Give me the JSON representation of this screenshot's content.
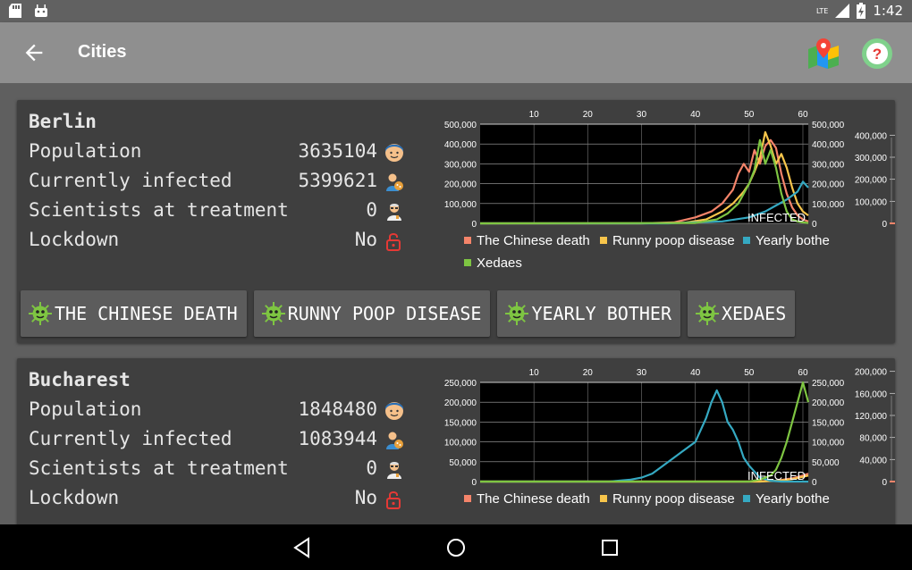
{
  "statusbar": {
    "lte": "LTE",
    "time": "1:42"
  },
  "appbar": {
    "title": "Cities"
  },
  "cities": [
    {
      "name": "Berlin",
      "population_label": "Population",
      "population": "3635104",
      "infected_label": "Currently infected",
      "infected": "5399621",
      "scientists_label": "Scientists at treatment",
      "scientists": "0",
      "lockdown_label": "Lockdown",
      "lockdown": "No"
    },
    {
      "name": "Bucharest",
      "population_label": "Population",
      "population": "1848480",
      "infected_label": "Currently infected",
      "infected": "1083944",
      "scientists_label": "Scientists at treatment",
      "scientists": "0",
      "lockdown_label": "Lockdown",
      "lockdown": "No"
    }
  ],
  "virus_buttons": [
    "THE CHINESE DEATH",
    "RUNNY POOP DISEASE",
    "YEARLY BOTHER",
    "XEDAES"
  ],
  "colors": {
    "chinese": "#f4846a",
    "runny": "#f7c54b",
    "yearly": "#35a9c2",
    "xedaes": "#7ec542"
  },
  "chart_data": [
    {
      "type": "line",
      "x_ticks": [
        10,
        20,
        30,
        40,
        50,
        60
      ],
      "left_ticks": [
        "0",
        "100,000",
        "200,000",
        "300,000",
        "400,000",
        "500,000"
      ],
      "left_ylim": [
        0,
        500000
      ],
      "right_ticks": [
        "0",
        "100,000",
        "200,000",
        "300,000",
        "400,000",
        "500,000"
      ],
      "right2_ticks": [
        "0",
        "100,000",
        "200,000",
        "300,000",
        "400,000"
      ],
      "annotation": "INFECTED",
      "legend": [
        "The Chinese death",
        "Runny poop disease",
        "Yearly bothe",
        "Xedaes"
      ],
      "series": [
        {
          "key": "chinese",
          "x": [
            0,
            30,
            36,
            40,
            43,
            45,
            47,
            48,
            49,
            50,
            51,
            52,
            53,
            54,
            55,
            56,
            57,
            58,
            59,
            60,
            61
          ],
          "values": [
            0,
            0,
            5000,
            30000,
            60000,
            100000,
            170000,
            250000,
            300000,
            260000,
            370000,
            300000,
            390000,
            420000,
            380000,
            250000,
            150000,
            80000,
            40000,
            20000,
            10000
          ]
        },
        {
          "key": "runny",
          "x": [
            0,
            30,
            38,
            42,
            45,
            47,
            49,
            50,
            51,
            52,
            53,
            54,
            55,
            56,
            57,
            58,
            59,
            60,
            61
          ],
          "values": [
            0,
            0,
            3000,
            20000,
            60000,
            100000,
            160000,
            200000,
            260000,
            330000,
            460000,
            390000,
            300000,
            350000,
            280000,
            180000,
            100000,
            60000,
            40000
          ]
        },
        {
          "key": "yearly",
          "x": [
            0,
            35,
            45,
            50,
            53,
            55,
            57,
            59,
            60,
            61
          ],
          "values": [
            0,
            0,
            10000,
            30000,
            60000,
            90000,
            120000,
            160000,
            210000,
            180000
          ]
        },
        {
          "key": "xedaes",
          "x": [
            0,
            40,
            44,
            46,
            48,
            49,
            50,
            51,
            52,
            53,
            54,
            55,
            56,
            57,
            58,
            59,
            60,
            61
          ],
          "values": [
            0,
            2000,
            20000,
            50000,
            100000,
            150000,
            200000,
            270000,
            420000,
            300000,
            370000,
            280000,
            150000,
            60000,
            20000,
            10000,
            5000,
            2000
          ]
        }
      ]
    },
    {
      "type": "line",
      "x_ticks": [
        10,
        20,
        30,
        40,
        50,
        60
      ],
      "left_ticks": [
        "0",
        "50,000",
        "100,000",
        "150,000",
        "200,000",
        "250,000"
      ],
      "left_ylim": [
        0,
        250000
      ],
      "right_ticks": [
        "0",
        "50,000",
        "100,000",
        "150,000",
        "200,000",
        "250,000"
      ],
      "right2_ticks": [
        "0",
        "40,000",
        "80,000",
        "120,000",
        "160,000",
        "200,000"
      ],
      "annotation": "INFECTED",
      "legend": [
        "The Chinese death",
        "Runny poop disease",
        "Yearly bothe"
      ],
      "series": [
        {
          "key": "chinese",
          "x": [
            0,
            50,
            55,
            58,
            60,
            61
          ],
          "values": [
            0,
            0,
            2000,
            8000,
            15000,
            20000
          ]
        },
        {
          "key": "runny",
          "x": [
            0,
            52,
            56,
            58,
            60,
            61
          ],
          "values": [
            0,
            0,
            3000,
            6000,
            12000,
            15000
          ]
        },
        {
          "key": "yearly",
          "x": [
            0,
            24,
            28,
            30,
            32,
            34,
            36,
            38,
            40,
            41,
            42,
            43,
            44,
            45,
            46,
            47,
            48,
            49,
            50,
            52,
            54,
            56,
            58,
            60,
            61
          ],
          "values": [
            0,
            0,
            5000,
            10000,
            20000,
            40000,
            60000,
            80000,
            100000,
            130000,
            160000,
            200000,
            230000,
            200000,
            150000,
            130000,
            100000,
            60000,
            40000,
            10000,
            2000,
            0,
            0,
            0,
            0
          ]
        },
        {
          "key": "xedaes",
          "x": [
            0,
            50,
            52,
            54,
            55,
            56,
            57,
            58,
            59,
            60,
            61
          ],
          "values": [
            0,
            0,
            5000,
            15000,
            30000,
            60000,
            100000,
            150000,
            200000,
            250000,
            200000
          ]
        }
      ]
    }
  ]
}
